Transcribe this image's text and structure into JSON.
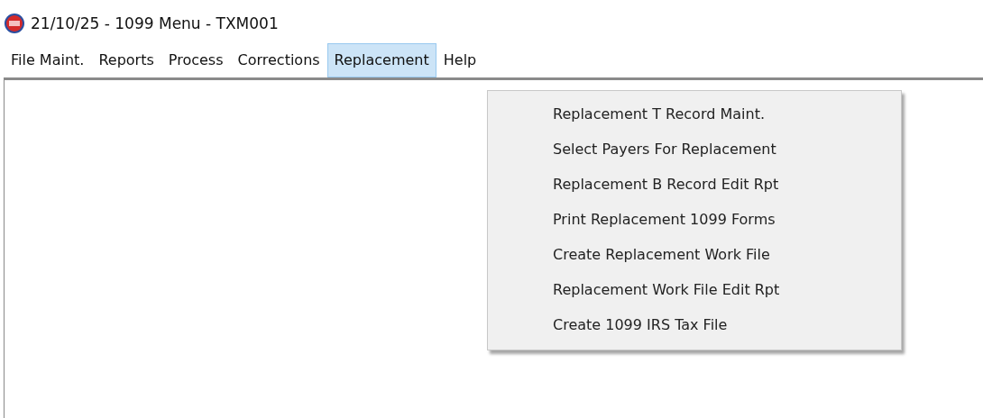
{
  "window": {
    "title": "21/10/25 - 1099 Menu - TXM001"
  },
  "menu_bar": [
    {
      "label": "File Maint.",
      "selected": false
    },
    {
      "label": "Reports",
      "selected": false
    },
    {
      "label": "Process",
      "selected": false
    },
    {
      "label": "Corrections",
      "selected": false
    },
    {
      "label": "Replacement",
      "selected": true
    },
    {
      "label": "Help",
      "selected": false
    }
  ],
  "dropdown": {
    "items": [
      "Replacement T Record Maint.",
      "Select Payers For Replacement",
      "Replacement B Record Edit Rpt",
      "Print Replacement 1099 Forms",
      "Create Replacement Work File",
      "Replacement Work File Edit Rpt",
      "Create 1099 IRS Tax File"
    ]
  }
}
